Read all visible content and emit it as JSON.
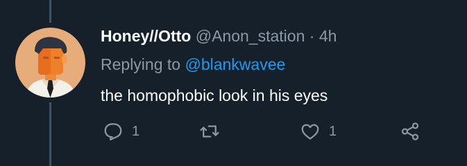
{
  "tweet": {
    "display_name": "Honey//Otto",
    "handle": "@Anon_station",
    "separator": "·",
    "time": "4h",
    "replying_prefix": "Replying to",
    "replying_to": "@blankwavee",
    "text": "the homophobic look in his eyes"
  },
  "actions": {
    "reply_icon": "reply-icon",
    "reply_count": "1",
    "retweet_icon": "retweet-icon",
    "like_icon": "heart-icon",
    "like_count": "1",
    "share_icon": "share-icon"
  },
  "colors": {
    "background": "#15202b",
    "text_primary": "#ffffff",
    "text_secondary": "#8b98a5",
    "link": "#1d9bf0",
    "thread_line": "#3d5466"
  }
}
